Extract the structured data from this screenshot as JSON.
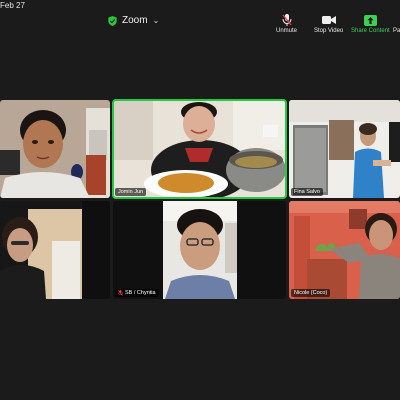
{
  "status_bar": {
    "date": "Feb 27"
  },
  "header": {
    "app_title": "Zoom",
    "accent": "#26c93d"
  },
  "toolbar": {
    "unmute": "Unmute",
    "stop_video": "Stop Video",
    "share_content": "Share Content",
    "partial_label": "Pa",
    "share_color": "#3fcf55"
  },
  "participants": [
    {
      "name": "",
      "active": false
    },
    {
      "name": "Jomin Jun",
      "active": true
    },
    {
      "name": "Fina Salvo",
      "active": false
    },
    {
      "name": "",
      "active": false
    },
    {
      "name": "SB / Chyntia",
      "active": false,
      "muted": true
    },
    {
      "name": "Nicole (Coco)",
      "active": false
    }
  ]
}
